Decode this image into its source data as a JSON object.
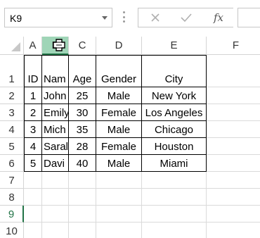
{
  "name_box": {
    "value": "K9"
  },
  "formula_bar": {
    "cancel_icon": "close-icon",
    "enter_icon": "check-icon",
    "fx_label": "fx",
    "formula_value": ""
  },
  "columns": [
    "A",
    "B",
    "C",
    "D",
    "E",
    "F"
  ],
  "selected_column": "B",
  "rows": [
    "1",
    "2",
    "3",
    "4",
    "5",
    "6",
    "7",
    "8",
    "9",
    "10"
  ],
  "selected_row": "9",
  "table": {
    "headers": [
      "ID",
      "Nam",
      "Age",
      "Gender",
      "City"
    ],
    "records": [
      [
        "1",
        "John",
        "25",
        "Male",
        "New York"
      ],
      [
        "2",
        "Emily",
        "30",
        "Female",
        "Los Angeles"
      ],
      [
        "3",
        "Mich",
        "35",
        "Male",
        "Chicago"
      ],
      [
        "4",
        "Saral",
        "28",
        "Female",
        "Houston"
      ],
      [
        "5",
        "Davi",
        "40",
        "Male",
        "Miami"
      ]
    ]
  },
  "colors": {
    "accent": "#217346",
    "selected_header": "#9fd5b7",
    "gridline": "#dadada"
  }
}
